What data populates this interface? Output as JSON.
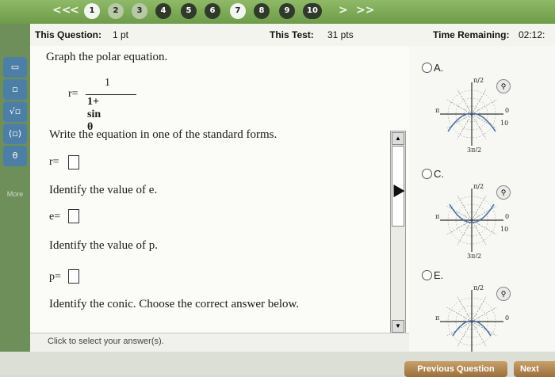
{
  "nav": {
    "back_all": "<<",
    "back": "<",
    "forward": ">",
    "forward_all": ">>",
    "questions": [
      {
        "label": "1",
        "state": "current"
      },
      {
        "label": "2",
        "state": "answered"
      },
      {
        "label": "3",
        "state": "answered"
      },
      {
        "label": "4",
        "state": "default"
      },
      {
        "label": "5",
        "state": "default"
      },
      {
        "label": "6",
        "state": "default"
      },
      {
        "label": "7",
        "state": "highlight"
      },
      {
        "label": "8",
        "state": "default"
      },
      {
        "label": "9",
        "state": "default"
      },
      {
        "label": "10",
        "state": "default"
      }
    ]
  },
  "header": {
    "this_question_label": "This Question:",
    "this_question_value": "1 pt",
    "this_test_label": "This Test:",
    "this_test_value": "31 pts",
    "time_label": "Time Remaining:",
    "time_value": "02:12:"
  },
  "sidebar": {
    "more": "More"
  },
  "question": {
    "prompt": "Graph the polar equation.",
    "eq_lhs": "r=",
    "numerator": "1",
    "denominator": "1+ sin θ",
    "step1": "Write the equation in one of the standard forms.",
    "step1_lhs": "r=",
    "step2": "Identify the value of e.",
    "step2_lhs": "e=",
    "step3": "Identify the value of p.",
    "step3_lhs": "p=",
    "step4": "Identify the conic. Choose the correct answer below."
  },
  "footer": {
    "hint": "Click to select your answer(s)."
  },
  "choices": [
    {
      "label": "A.",
      "tick_top": "π/2",
      "tick_left": "π",
      "tick_right": "0",
      "tick_bottom": "3π/2",
      "extra": "10"
    },
    {
      "label": "C.",
      "tick_top": "π/2",
      "tick_left": "π",
      "tick_right": "0",
      "tick_bottom": "3π/2",
      "extra": "10"
    },
    {
      "label": "E.",
      "tick_top": "π/2",
      "tick_left": "π",
      "tick_right": "0",
      "tick_bottom": "",
      "extra": ""
    }
  ],
  "bottom": {
    "previous": "Previous Question",
    "next": "Next"
  },
  "colors": {
    "top_bar": "#7aa653",
    "sidebar": "#6e8f5a",
    "button_brown": "#b5884f",
    "graph_curve": "#4a6fa5"
  }
}
